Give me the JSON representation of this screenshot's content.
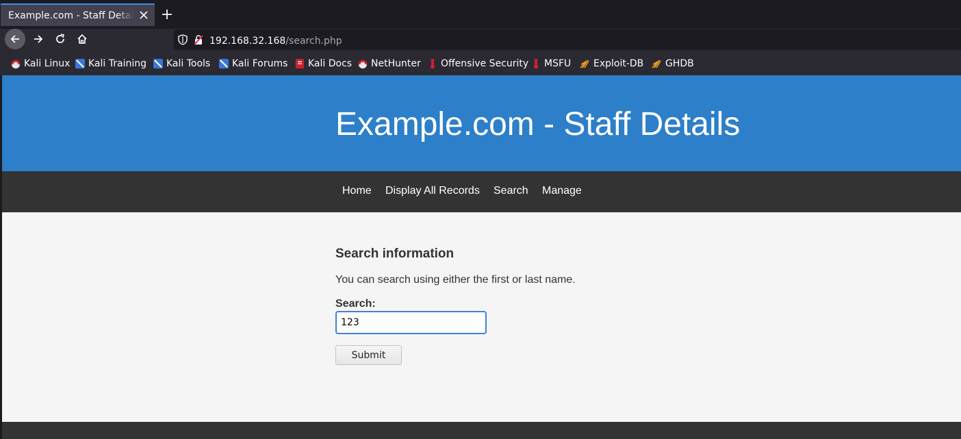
{
  "browser": {
    "tab": {
      "title": "Example.com - Staff Details",
      "close_icon": "close-icon"
    },
    "new_tab_icon": "plus-icon",
    "toolbar": {
      "back_icon": "arrow-left-icon",
      "forward_icon": "arrow-right-icon",
      "reload_icon": "reload-icon",
      "home_icon": "home-icon"
    },
    "url": {
      "host": "192.168.32.168",
      "path": "/search.php",
      "security_icons": [
        "shield-icon",
        "insecure-lock-icon"
      ]
    },
    "bookmarks": [
      {
        "label": "Kali Linux",
        "icon": "kali-icon"
      },
      {
        "label": "Kali Training",
        "icon": "kali-training-icon"
      },
      {
        "label": "Kali Tools",
        "icon": "kali-tools-icon"
      },
      {
        "label": "Kali Forums",
        "icon": "kali-forums-icon"
      },
      {
        "label": "Kali Docs",
        "icon": "kali-docs-icon"
      },
      {
        "label": "NetHunter",
        "icon": "nethunter-icon"
      },
      {
        "label": "Offensive Security",
        "icon": "offsec-icon"
      },
      {
        "label": "MSFU",
        "icon": "msfu-icon"
      },
      {
        "label": "Exploit-DB",
        "icon": "exploitdb-icon"
      },
      {
        "label": "GHDB",
        "icon": "ghdb-icon"
      }
    ]
  },
  "page": {
    "header_title": "Example.com - Staff Details",
    "nav": [
      "Home",
      "Display All Records",
      "Search",
      "Manage"
    ],
    "form": {
      "heading": "Search information",
      "description": "You can search using either the first or last name.",
      "search_label": "Search:",
      "search_value": "123",
      "submit_label": "Submit"
    }
  },
  "colors": {
    "header_blue": "#2c7fc8",
    "nav_dark": "#333333",
    "page_bg": "#f5f5f5",
    "input_focus": "#3c82d6",
    "tab_accent": "#3d8fe6"
  }
}
